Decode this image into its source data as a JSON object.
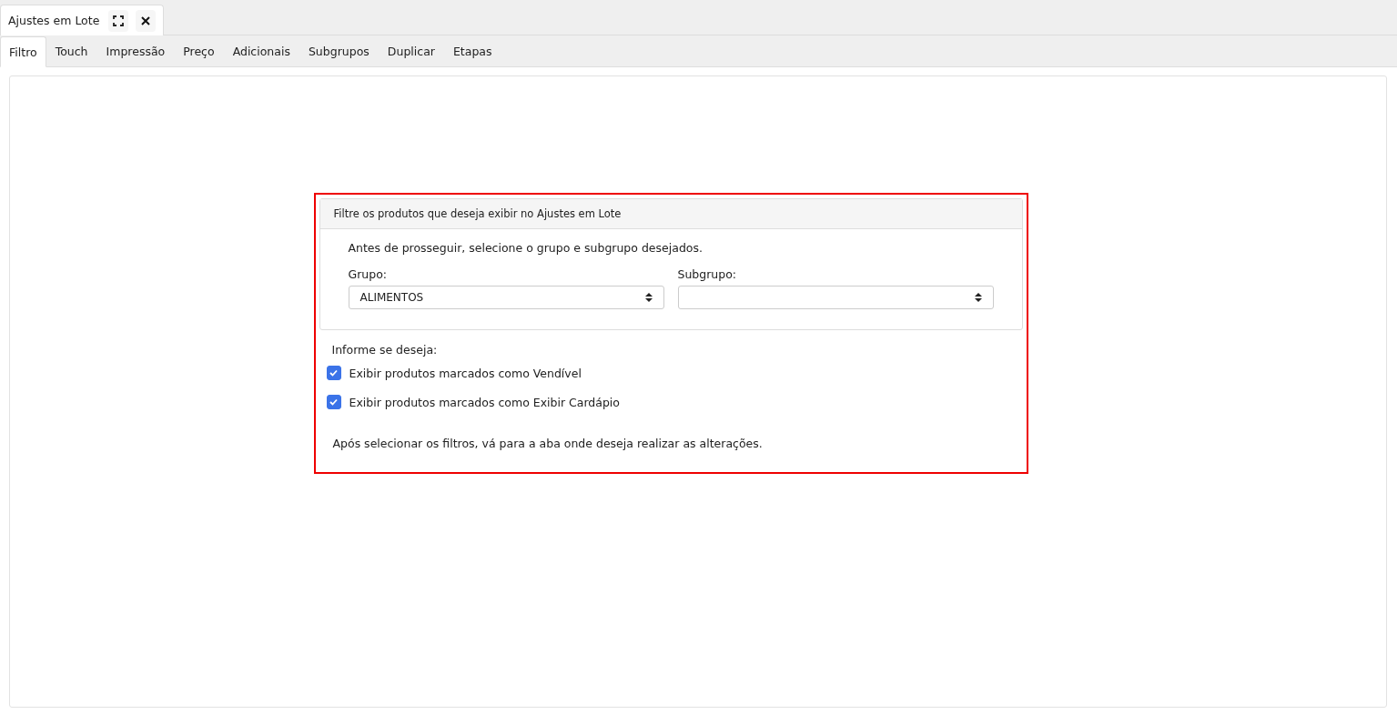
{
  "document_tab": {
    "title": "Ajustes em Lote"
  },
  "tabs": [
    {
      "label": "Filtro",
      "selected": true
    },
    {
      "label": "Touch",
      "selected": false
    },
    {
      "label": "Impressão",
      "selected": false
    },
    {
      "label": "Preço",
      "selected": false
    },
    {
      "label": "Adicionais",
      "selected": false
    },
    {
      "label": "Subgrupos",
      "selected": false
    },
    {
      "label": "Duplicar",
      "selected": false
    },
    {
      "label": "Etapas",
      "selected": false
    }
  ],
  "filter_card": {
    "header": "Filtre os produtos que deseja exibir no Ajustes em Lote",
    "instruction": "Antes de prosseguir, selecione o grupo e subgrupo desejados.",
    "fields": [
      {
        "label": "Grupo:",
        "value": "ALIMENTOS"
      },
      {
        "label": "Subgrupo:"
      }
    ]
  },
  "options_label": "Informe se deseja:",
  "options": [
    {
      "label": "Exibir produtos marcados como Vendível",
      "checked": true
    },
    {
      "label": "Exibir produtos marcados como Exibir Cardápio",
      "checked": true
    }
  ],
  "footer_note": "Após selecionar os filtros, vá para a aba onde deseja realizar as alterações."
}
